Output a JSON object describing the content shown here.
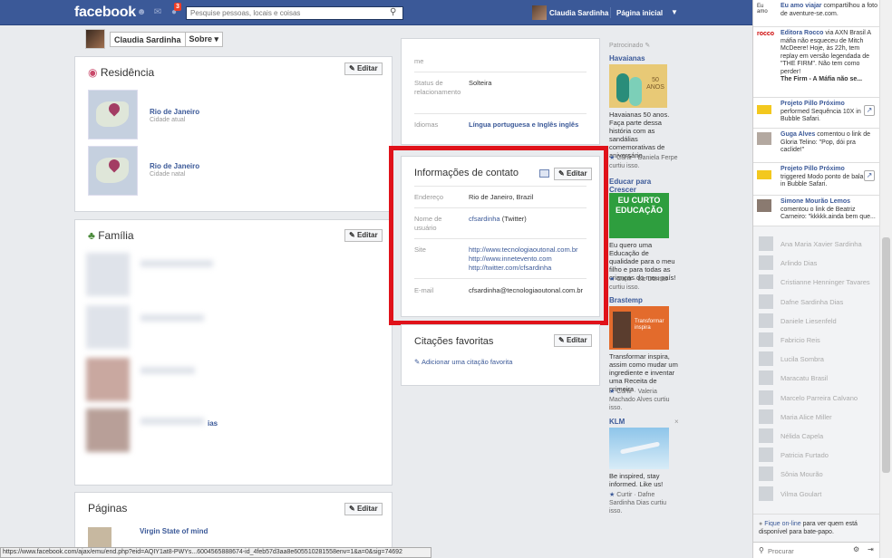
{
  "topbar": {
    "logo": "facebook",
    "notifications_badge": "3",
    "search_placeholder": "Pesquise pessoas, locais e coisas",
    "user_name": "Claudia Sardinha",
    "home": "Página inicial"
  },
  "profile": {
    "name": "Claudia Sardinha",
    "section": "Sobre"
  },
  "residence": {
    "title": "Residência",
    "edit": "Editar",
    "places": [
      {
        "city": "Rio de Janeiro",
        "kind": "Cidade atual"
      },
      {
        "city": "Rio de Janeiro",
        "kind": "Cidade natal"
      }
    ]
  },
  "family": {
    "title": "Família",
    "edit": "Editar",
    "fragment": "ias"
  },
  "pages": {
    "title": "Páginas",
    "edit": "Editar",
    "first": "Virgin State of mind"
  },
  "about": {
    "fragment": "me",
    "rows": [
      {
        "label": "Status de relacionamento",
        "value": "Solteira"
      },
      {
        "label": "Idiomas",
        "value": "Língua portuguesa e Inglês inglês"
      }
    ]
  },
  "contact": {
    "title": "Informações de contato",
    "edit": "Editar",
    "address_label": "Endereço",
    "address": "Rio de Janeiro, Brazil",
    "username_label": "Nome de usuário",
    "username": "cfsardinha",
    "username_suffix": "(Twitter)",
    "site_label": "Site",
    "sites": [
      "http://www.tecnologiaoutonal.com.br",
      "http://www.innetevento.com",
      "http://twitter.com/cfsardinha"
    ],
    "email_label": "E-mail",
    "email": "cfsardinha@tecnologiaoutonal.com.br",
    "highlight_color": "#e0121a"
  },
  "quotes": {
    "title": "Citações favoritas",
    "edit": "Editar",
    "add": "Adicionar uma citação favorita"
  },
  "ads": {
    "sponsored": "Patrocinado",
    "items": [
      {
        "head": "Havaianas",
        "text": "Havaianas 50 anos. Faça parte dessa história com as sandálias comemorativas de aniversário",
        "like": "Curtir · Daniela Ferpe curtiu isso.",
        "img_text": "50 ANOS"
      },
      {
        "head": "Educar para Crescer",
        "text": "Eu quero uma Educação de qualidade para o meu filho e para todas as crianças do meu país!",
        "like": "Curtir · Liz Dantas curtiu isso.",
        "img_text": "EU CURTO EDUCAÇÃO"
      },
      {
        "head": "Brastemp",
        "text": "Transformar inspira, assim como mudar um ingrediente e inventar uma Receita de primeira",
        "like": "Curtir · Valeria Machado Alves curtiu isso.",
        "img_text": "Transformar inspira"
      },
      {
        "head": "KLM",
        "text": "Be inspired, stay informed. Like us!",
        "like": "Curtir · Dafne Sardinha Dias curtiu isso."
      }
    ]
  },
  "ticker": [
    {
      "who": "Eu amo viajar",
      "text": "compartilhou a foto de aventure-se.com."
    },
    {
      "who": "Editora Rocco",
      "text": "via AXN Brasil A máfia não esqueceu de Mitch McDeere! Hoje, às 22h, tem replay em versão legendada de \"THE FIRM\". Não tem como perder!",
      "extra": "The Firm - A Máfia não se..."
    },
    {
      "who": "Projeto Pillo Próximo",
      "text": "performed Sequência 10X in Bubble Safari."
    },
    {
      "who": "Guga Alves",
      "text": "comentou o link de Gloria Telino: \"Pop, dói pra caclide!\""
    },
    {
      "who": "Projeto Pillo Próximo",
      "text": "triggered Modo ponto de bala in Bubble Safari."
    },
    {
      "who": "Simone Mourão Lemos",
      "text": "comentou o link de Beatriz Carneiro: \"kkkkk.ainda bem que..."
    }
  ],
  "friends": [
    "Ana Maria Xavier Sardinha",
    "Arlindo Dias",
    "Cristianne Henninger Tavares",
    "Dafne Sardinha Dias",
    "Daniele Liesenfeld",
    "Fabricio Reis",
    "Lucila Sombra",
    "Maracatu Brasil",
    "Marcelo Parreira Calvano",
    "Maria Alice Miller",
    "Nélida Capela",
    "Patricia Furtado",
    "Sônia Mourão",
    "Vilma Goulart"
  ],
  "chat": {
    "prompt_link": "Fique on-line",
    "prompt": "para ver quem está disponível para bate-papo.",
    "search": "Procurar"
  },
  "status_url": "https://www.facebook.com/ajax/emu/end.php?eid=AQIY1at8-PWYs...6004565888674-id_4feb57d3aa8e605510281558env=1&a=0&sig=74692"
}
